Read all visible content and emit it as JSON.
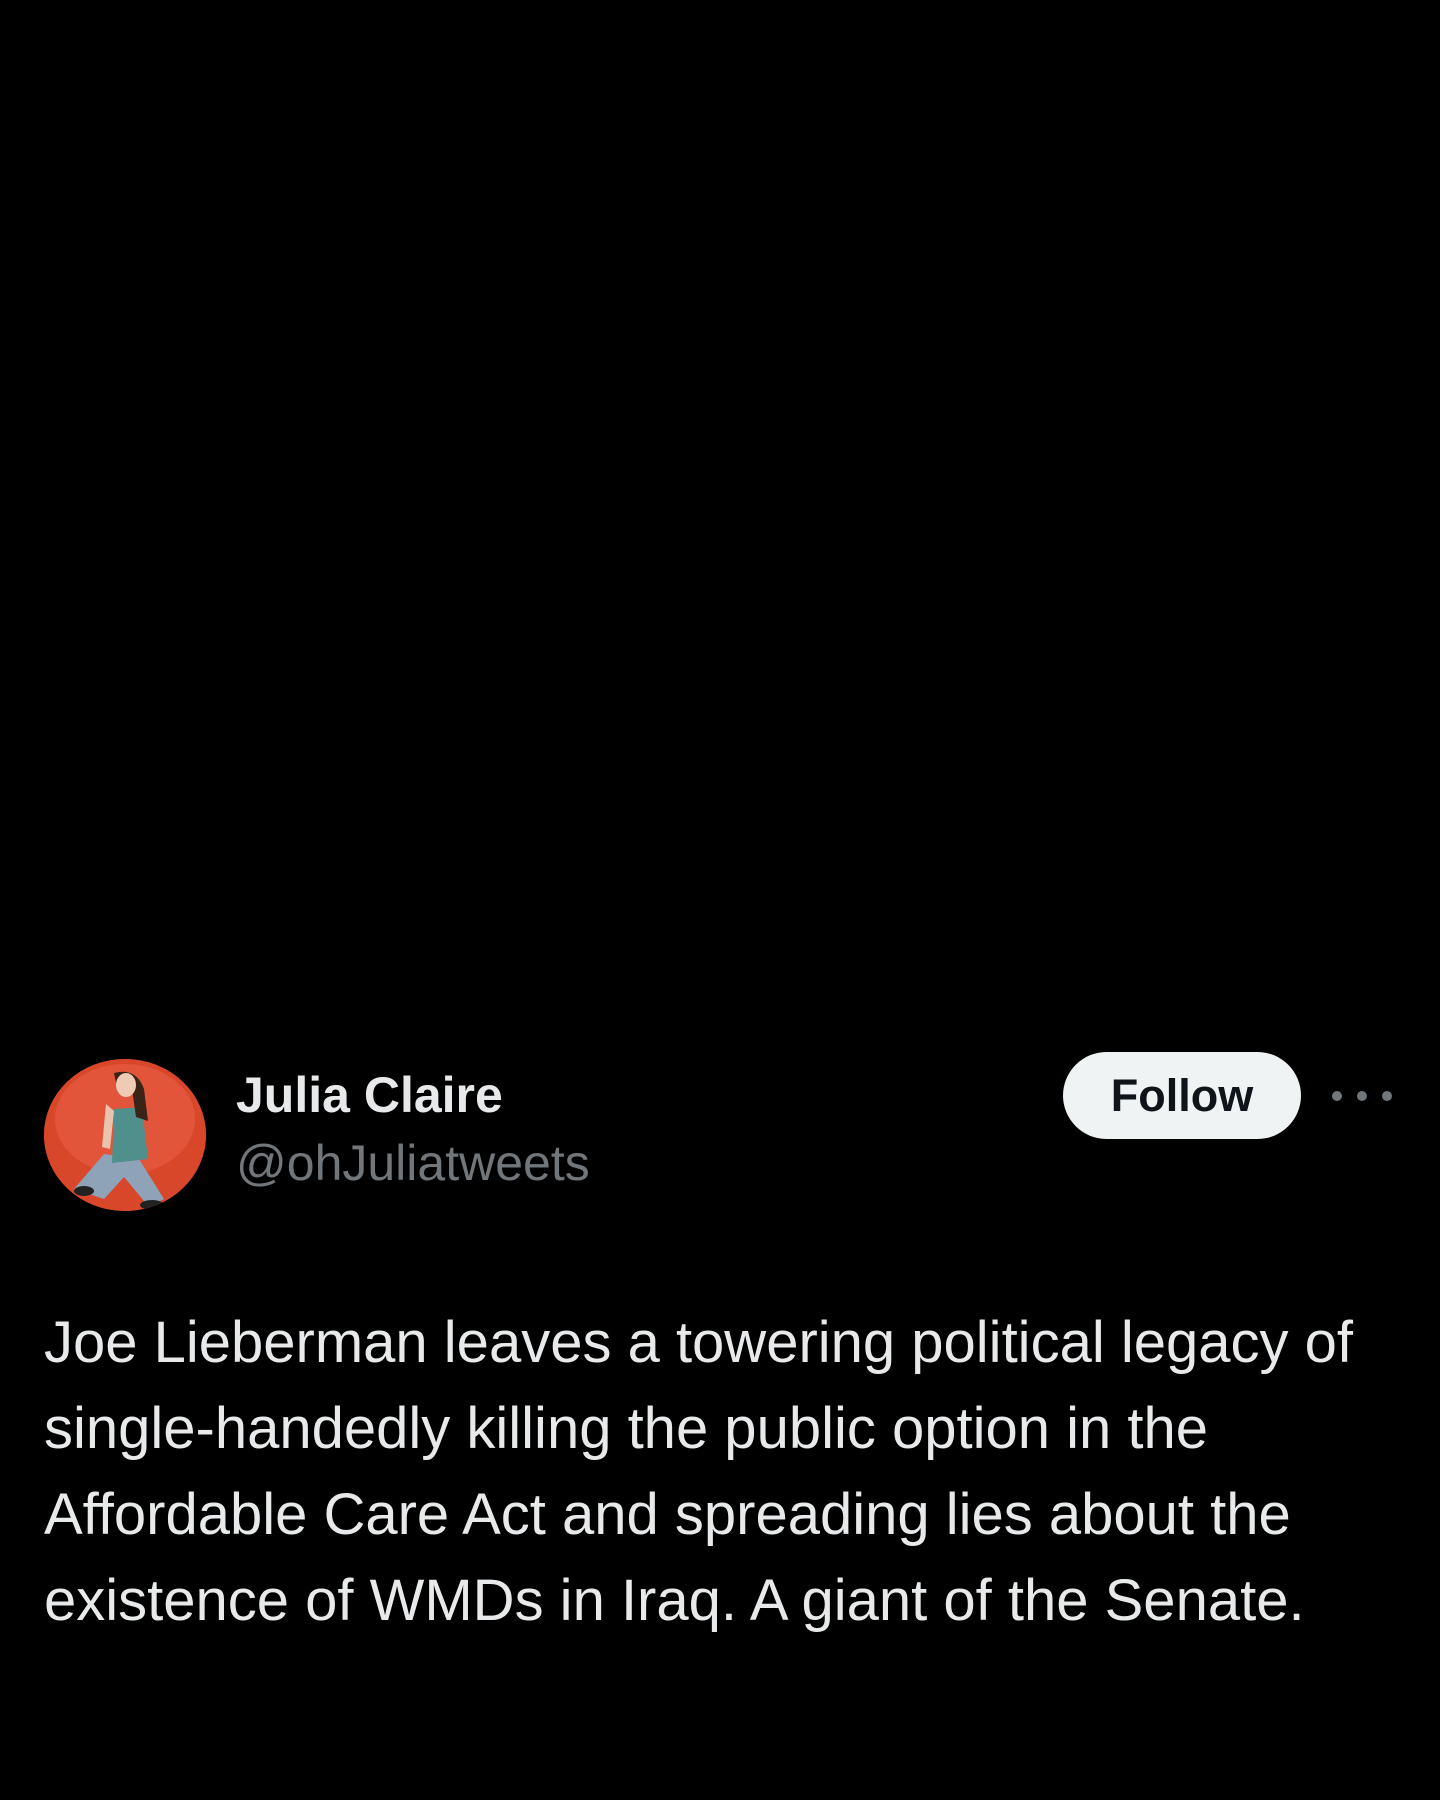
{
  "tweet": {
    "author": {
      "display_name": "Julia Claire",
      "handle": "@ohJuliatweets",
      "avatar_icon": "profile-photo"
    },
    "follow_label": "Follow",
    "more_icon": "more-options-icon",
    "text": "Joe Lieberman leaves a towering political legacy of single-handedly killing the public option in the Affordable Care Act and spreading lies about the existence of WMDs in Iraq. A giant of the Senate."
  },
  "colors": {
    "background": "#000000",
    "primary_text": "#e7e9ea",
    "secondary_text": "#71767b",
    "follow_button_bg": "#eff3f4",
    "follow_button_text": "#0f1419",
    "avatar_bg": "#d9472a"
  }
}
